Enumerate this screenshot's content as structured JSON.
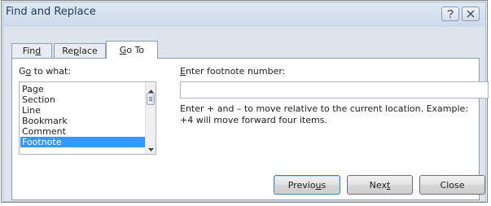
{
  "window": {
    "title": "Find and Replace"
  },
  "tabs": [
    {
      "label_pre": "Fin",
      "label_acc": "d",
      "label_post": ""
    },
    {
      "label_pre": "Re",
      "label_acc": "p",
      "label_post": "lace"
    },
    {
      "label_pre": "",
      "label_acc": "G",
      "label_post": "o To"
    }
  ],
  "goto": {
    "label_pre": "G",
    "label_acc": "o",
    "label_post": " to what:",
    "items": [
      "Page",
      "Section",
      "Line",
      "Bookmark",
      "Comment",
      "Footnote"
    ],
    "selected": "Footnote"
  },
  "entry": {
    "label_acc": "E",
    "label_post": "nter footnote number:",
    "value": "",
    "help": "Enter + and – to move relative to the current location. Example: +4 will move forward four items."
  },
  "buttons": {
    "previous_pre": "Previo",
    "previous_acc": "u",
    "previous_post": "s",
    "next_pre": "Nex",
    "next_acc": "t",
    "next_post": "",
    "close": "Close"
  },
  "icons": {
    "help": "question-mark-icon",
    "close": "close-x-icon"
  }
}
